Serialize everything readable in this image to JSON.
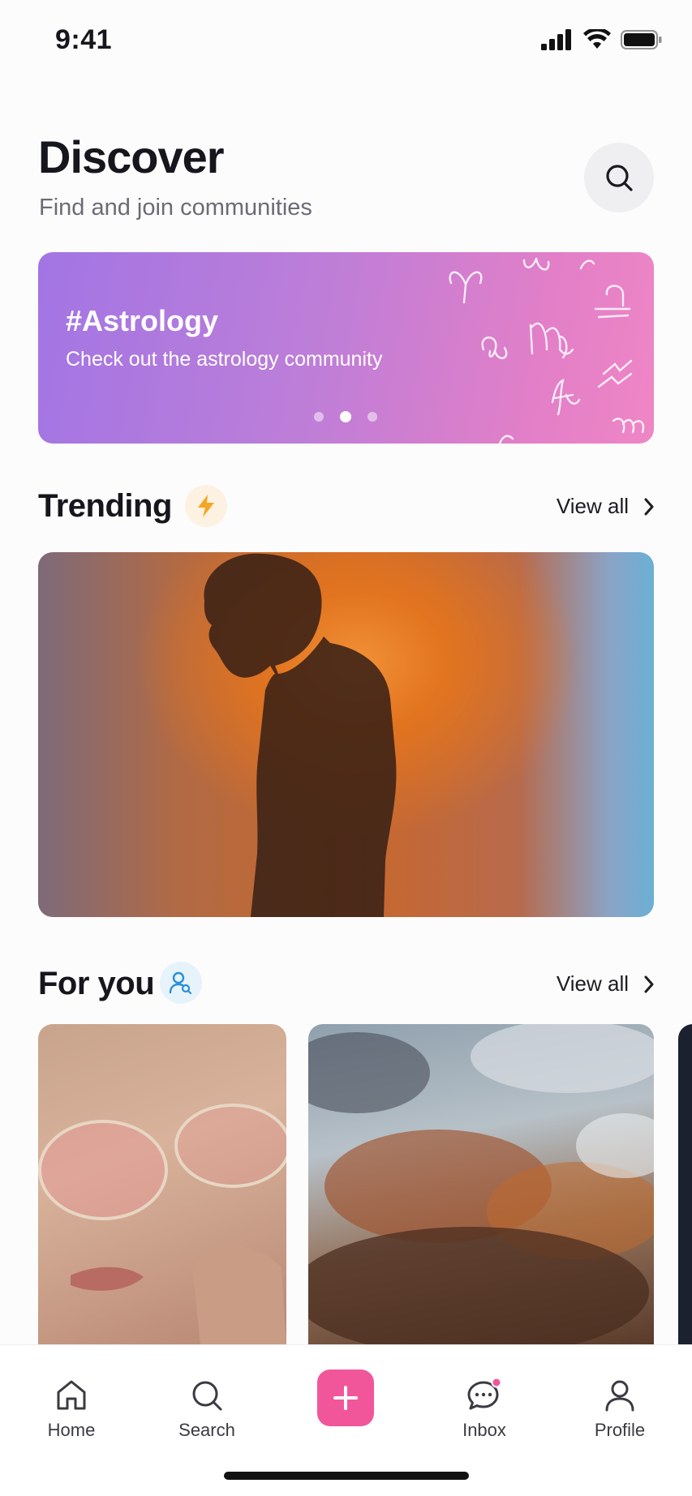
{
  "status_bar": {
    "time": "9:41"
  },
  "header": {
    "title": "Discover",
    "subtitle": "Find and join communities"
  },
  "banner": {
    "title": "#Astrology",
    "text": "Check out the astrology community",
    "page_count": 3,
    "active_page": 2,
    "gradient": [
      "#a275e4",
      "#ef86c5"
    ]
  },
  "sections": {
    "trending": {
      "title": "Trending",
      "view_all": "View all",
      "icon": "lightning-icon",
      "accent": "#f5a623"
    },
    "for_you": {
      "title": "For you",
      "view_all": "View all",
      "icon": "user-search-icon",
      "accent": "#2b8fd6"
    }
  },
  "tabbar": {
    "items": [
      {
        "label": "Home",
        "icon": "home-icon"
      },
      {
        "label": "Search",
        "icon": "search-icon"
      },
      {
        "label": "",
        "icon": "plus-icon"
      },
      {
        "label": "Inbox",
        "icon": "chat-icon",
        "has_notification": true
      },
      {
        "label": "Profile",
        "icon": "profile-icon"
      }
    ],
    "accent": "#f2569a"
  }
}
